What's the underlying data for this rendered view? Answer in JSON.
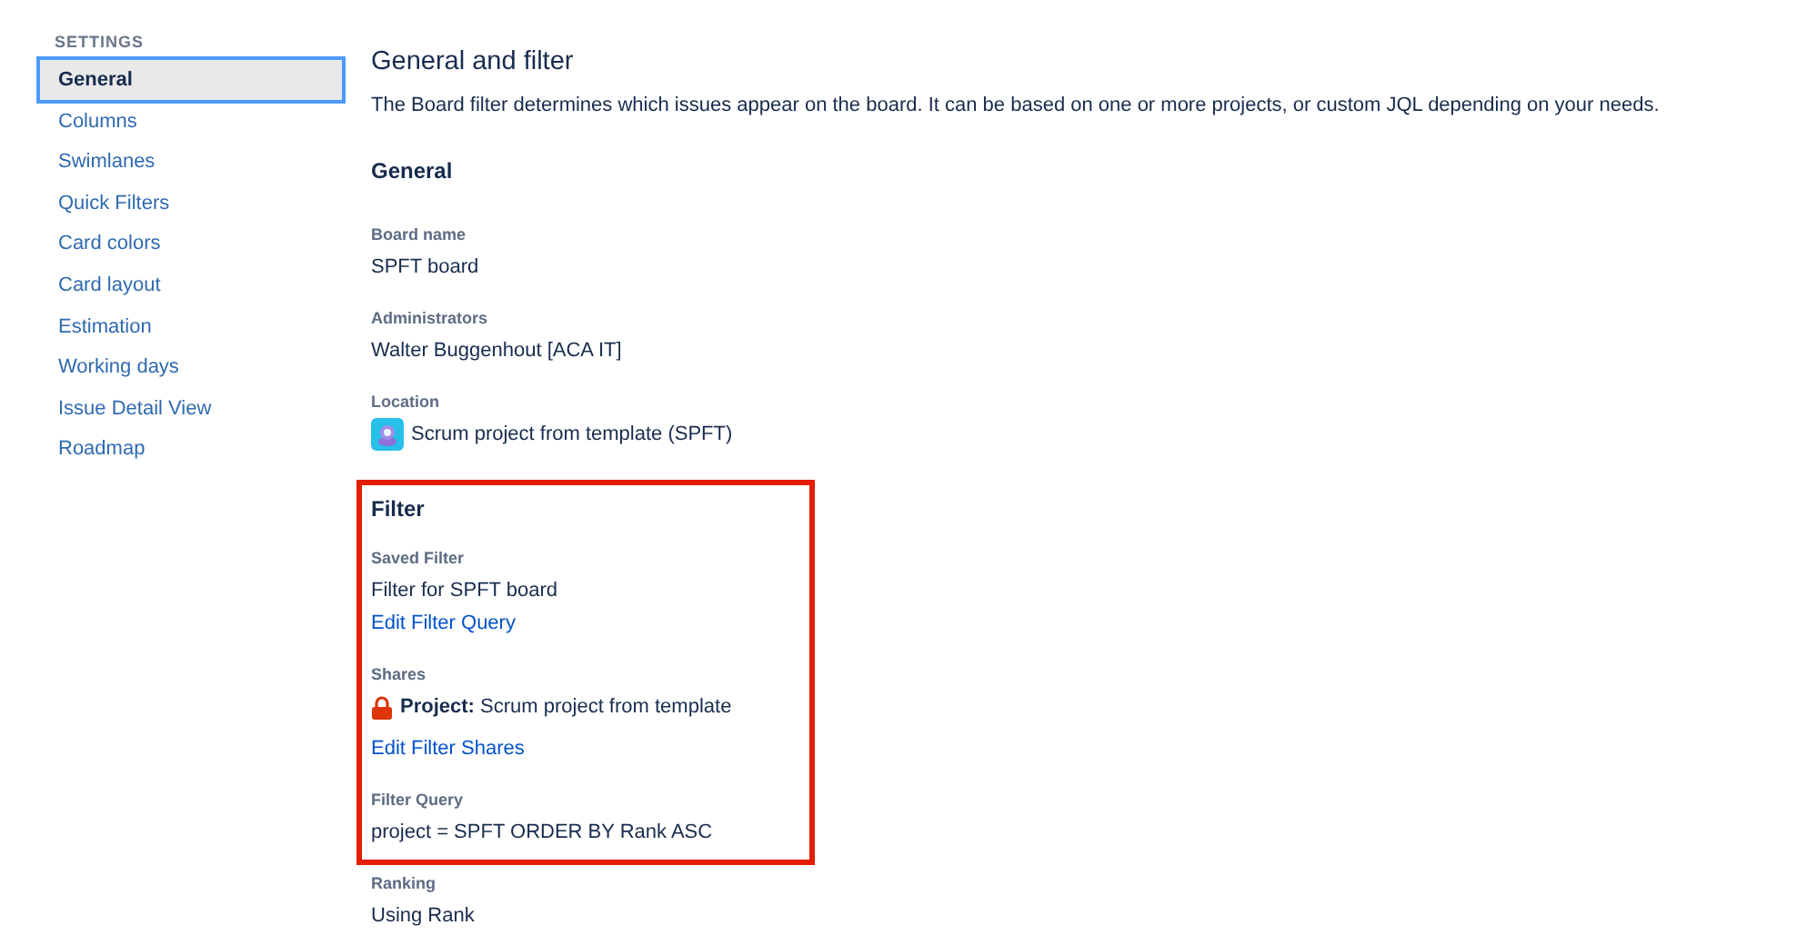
{
  "sidebar": {
    "heading": "SETTINGS",
    "items": [
      {
        "label": "General",
        "selected": true
      },
      {
        "label": "Columns",
        "selected": false
      },
      {
        "label": "Swimlanes",
        "selected": false
      },
      {
        "label": "Quick Filters",
        "selected": false
      },
      {
        "label": "Card colors",
        "selected": false
      },
      {
        "label": "Card layout",
        "selected": false
      },
      {
        "label": "Estimation",
        "selected": false
      },
      {
        "label": "Working days",
        "selected": false
      },
      {
        "label": "Issue Detail View",
        "selected": false
      },
      {
        "label": "Roadmap",
        "selected": false
      }
    ]
  },
  "main": {
    "title": "General and filter",
    "description": "The Board filter determines which issues appear on the board. It can be based on one or more projects, or custom JQL depending on your needs.",
    "sections": [
      {
        "heading": "General",
        "highlighted": false,
        "fields": [
          {
            "label": "Board name",
            "kind": "text",
            "value": "SPFT board"
          },
          {
            "label": "Administrators",
            "kind": "text",
            "value": "Walter Buggenhout [ACA IT]"
          },
          {
            "label": "Location",
            "kind": "project",
            "value": "Scrum project from template (SPFT)"
          }
        ]
      },
      {
        "heading": "Filter",
        "highlighted": true,
        "fields": [
          {
            "label": "Saved Filter",
            "kind": "text",
            "value": "Filter for SPFT board",
            "link": "Edit Filter Query"
          },
          {
            "label": "Shares",
            "kind": "share",
            "value": "**Project:** Scrum project from template",
            "link": "Edit Filter Shares"
          },
          {
            "label": "Filter Query",
            "kind": "text",
            "value": "project = SPFT ORDER BY Rank ASC"
          }
        ]
      },
      {
        "highlighted": false,
        "fields": [
          {
            "label": "Ranking",
            "kind": "text",
            "value": "Using Rank"
          }
        ]
      }
    ]
  }
}
